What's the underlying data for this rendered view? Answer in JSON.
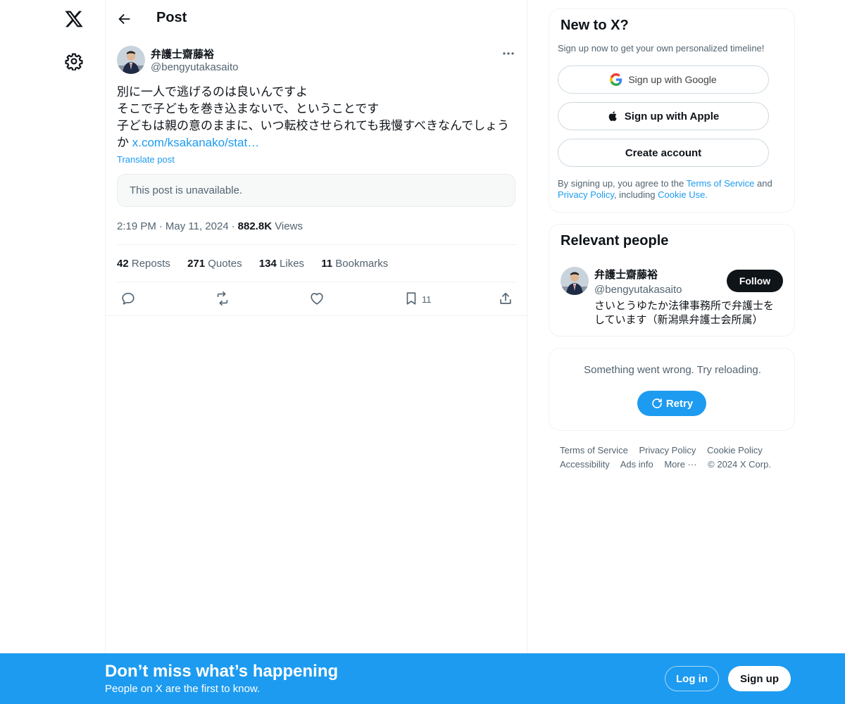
{
  "nav": {
    "logo_icon": "x-logo-icon",
    "settings_icon": "gear-icon"
  },
  "header": {
    "back_icon": "arrow-left-icon",
    "title": "Post"
  },
  "post": {
    "author_name": "弁護士齋藤裕",
    "author_handle": "@bengyutakasaito",
    "text_lines": [
      "別に一人で逃げるのは良いんですよ",
      "そこで子どもを巻き込まないで、ということです",
      "子どもは親の意のままに、いつ転校させられても我慢すべきなんでしょう"
    ],
    "last_line_prefix": "か ",
    "link_text": "x.com/ksakanako/stat…",
    "translate_label": "Translate post",
    "quoted_unavailable": "This post is unavailable.",
    "time": "2:19 PM",
    "date": "May 11, 2024",
    "views_count": "882.8K",
    "views_label": "Views",
    "separator": "·",
    "stats": {
      "reposts_count": "42",
      "reposts_label": "Reposts",
      "quotes_count": "271",
      "quotes_label": "Quotes",
      "likes_count": "134",
      "likes_label": "Likes",
      "bookmarks_count": "11",
      "bookmarks_label": "Bookmarks"
    },
    "actions": {
      "bookmark_count": "11"
    }
  },
  "sidebar": {
    "new_to_x": {
      "title": "New to X?",
      "subtitle": "Sign up now to get your own personalized timeline!",
      "google_button": "Sign up with Google",
      "apple_button": "Sign up with Apple",
      "create_button": "Create account",
      "legal_prefix": "By signing up, you agree to the ",
      "terms_link": "Terms of Service",
      "legal_and": " and ",
      "privacy_link": "Privacy Policy",
      "legal_including": ", including ",
      "cookie_link": "Cookie Use."
    },
    "relevant_people": {
      "title": "Relevant people",
      "name": "弁護士齋藤裕",
      "handle": "@bengyutakasaito",
      "bio": "さいとうゆたか法律事務所で弁護士をしています（新潟県弁護士会所属）",
      "follow_button": "Follow"
    },
    "error_card": {
      "message": "Something went wrong. Try reloading.",
      "retry_button": "Retry"
    },
    "footer_links": [
      "Terms of Service",
      "Privacy Policy",
      "Cookie Policy",
      "Accessibility",
      "Ads info",
      "More ···",
      "© 2024 X Corp."
    ]
  },
  "banner": {
    "title": "Don’t miss what’s happening",
    "subtitle": "People on X are the first to know.",
    "login_button": "Log in",
    "signup_button": "Sign up"
  },
  "colors": {
    "accent": "#1d9bf0",
    "text_primary": "#0f1419",
    "text_secondary": "#536471",
    "border": "#eff3f4"
  }
}
